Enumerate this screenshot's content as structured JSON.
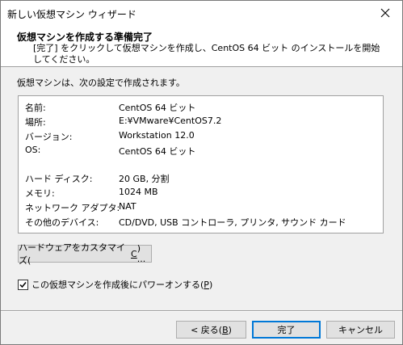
{
  "window": {
    "title": "新しい仮想マシン ウィザード"
  },
  "header": {
    "title": "仮想マシンを作成する準備完了",
    "description": "[完了] をクリックして仮想マシンを作成し、CentOS 64 ビット のインストールを開始してください。"
  },
  "main": {
    "intro": "仮想マシンは、次の設定で作成されます。"
  },
  "summary": {
    "rows": [
      {
        "key": "名前:",
        "value": "CentOS 64 ビット"
      },
      {
        "key": "場所:",
        "value": "E:¥VMware¥CentOS7.2"
      },
      {
        "key": "バージョン:",
        "value": "Workstation 12.0"
      },
      {
        "key": "OS:",
        "value": "CentOS 64 ビット"
      },
      {
        "key": "ハード ディスク:",
        "value": "20 GB, 分割"
      },
      {
        "key": "メモリ:",
        "value": "1024 MB"
      },
      {
        "key": "ネットワーク アダプタ:",
        "value": "NAT"
      },
      {
        "key": "その他のデバイス:",
        "value": "CD/DVD, USB コントローラ, プリンタ, サウンド カード"
      }
    ]
  },
  "buttons": {
    "customize": {
      "text": "ハードウェアをカスタマイズ(",
      "key": "C",
      "suffix": ") ..."
    },
    "back": {
      "text": "< 戻る(",
      "key": "B",
      "suffix": ")"
    },
    "finish": "完了",
    "cancel": "キャンセル"
  },
  "power_on": {
    "checked": true,
    "text": "この仮想マシンを作成後にパワーオンする(",
    "key": "P",
    "suffix": ")"
  }
}
